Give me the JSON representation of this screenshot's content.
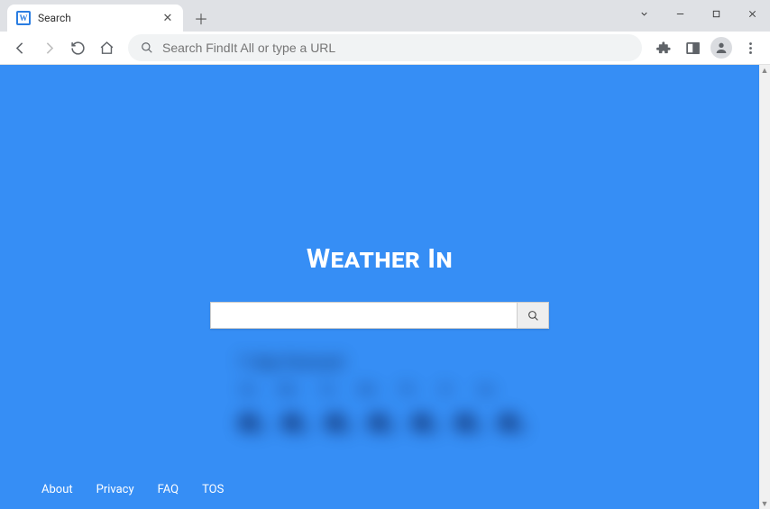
{
  "browser": {
    "tab_title": "Search",
    "omnibox_placeholder": "Search FindIt All or type a URL"
  },
  "page": {
    "heading": "Weather In",
    "search_value": "",
    "widget_title": "7-day forecast",
    "days": [
      "Su",
      "Mo",
      "Tu",
      "We",
      "Th",
      "Fr",
      "Sa"
    ]
  },
  "footer": {
    "links": [
      "About",
      "Privacy",
      "FAQ",
      "TOS"
    ]
  }
}
